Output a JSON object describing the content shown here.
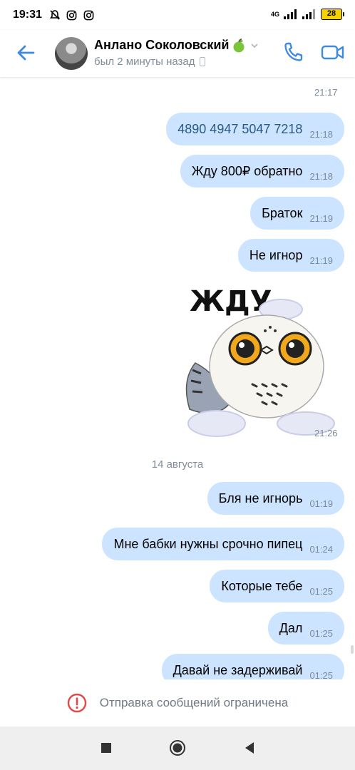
{
  "status_bar": {
    "time": "19:31",
    "signal_label": "4G",
    "battery": "28"
  },
  "header": {
    "contact_name": "Анлано Соколовский",
    "last_seen": "был 2 минуты назад",
    "icons": [
      "back-arrow-icon",
      "avatar",
      "apple-emoji-icon",
      "chevron-down-icon",
      "phone-icon",
      "video-camera-icon"
    ],
    "accent_color": "#3f8ae0"
  },
  "messages": [
    {
      "type": "sticker_partial",
      "time": "21:17"
    },
    {
      "type": "text",
      "text": "4890 4947 5047 7218",
      "time": "21:18",
      "link": true
    },
    {
      "type": "text",
      "text": "Жду 800₽ обратно",
      "time": "21:18"
    },
    {
      "type": "text",
      "text": "Браток",
      "time": "21:19"
    },
    {
      "type": "text",
      "text": "Не игнор",
      "time": "21:19"
    },
    {
      "type": "sticker",
      "caption": "ЖДУ",
      "time": "21:26"
    },
    {
      "type": "date",
      "text": "14 августа"
    },
    {
      "type": "text",
      "text": "Бля не игнорь",
      "time": "01:19"
    },
    {
      "type": "text",
      "text": "Мне бабки нужны срочно пипец",
      "time": "01:24"
    },
    {
      "type": "text",
      "text": "Которые тебе",
      "time": "01:25"
    },
    {
      "type": "text",
      "text": "Дал",
      "time": "01:25"
    },
    {
      "type": "text",
      "text": "Давай не задерживай",
      "time": "01:25"
    }
  ],
  "restricted": {
    "text": "Отправка сообщений ограничена",
    "color": "#e64646"
  },
  "bubble_color": "#cce4ff"
}
